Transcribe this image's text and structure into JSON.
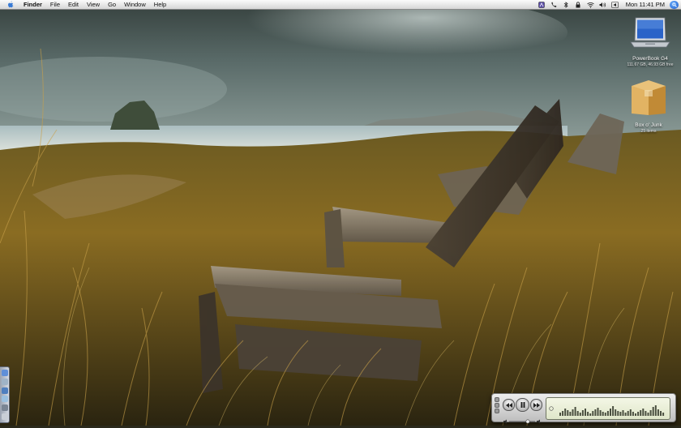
{
  "menubar": {
    "app_name": "Finder",
    "items": [
      "File",
      "Edit",
      "View",
      "Go",
      "Window",
      "Help"
    ],
    "clock": "Mon 11:41 PM"
  },
  "desktop": {
    "icons": [
      {
        "name": "PowerBook G4",
        "info": "111.67 GB, 46.93 GB free"
      },
      {
        "name": "Box o' Junk",
        "info": "25 items"
      }
    ]
  },
  "mini_player": {
    "spectrum": [
      4,
      6,
      9,
      7,
      5,
      8,
      11,
      6,
      4,
      7,
      9,
      5,
      3,
      6,
      8,
      10,
      7,
      5,
      4,
      6,
      9,
      12,
      8,
      6,
      5,
      7,
      4,
      6,
      8,
      5,
      3,
      5,
      7,
      9,
      6,
      4,
      7,
      11,
      13,
      8,
      6,
      4
    ]
  },
  "colors": {
    "menubar": "#e8e8e8",
    "sky": "#3a4a4a",
    "ocean": "#8fa7ae",
    "grass": "#9a7a2a"
  }
}
